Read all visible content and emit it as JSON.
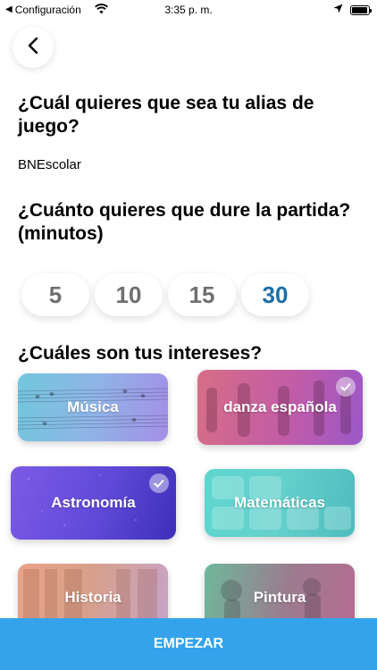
{
  "status_bar": {
    "back_app": "Configuración",
    "time": "3:35 p. m.",
    "battery_level": 0.95
  },
  "back_button": {
    "icon": "chevron-left-icon"
  },
  "alias_section": {
    "question": "¿Cuál quieres que sea tu alias de juego?",
    "value": "BNEscolar"
  },
  "duration_section": {
    "question": "¿Cuánto quieres que dure la partida? (minutos)",
    "options": [
      "5",
      "10",
      "15",
      "30"
    ],
    "selected": "30",
    "accent_color": "#1b6fa8"
  },
  "interests_section": {
    "question": "¿Cuáles son tus intereses?",
    "items": [
      {
        "label": "Música",
        "selected": false
      },
      {
        "label": "danza española",
        "selected": true
      },
      {
        "label": "Astronomía",
        "selected": true
      },
      {
        "label": "Matemáticas",
        "selected": false
      },
      {
        "label": "Historia",
        "selected": false
      },
      {
        "label": "Pintura",
        "selected": false
      }
    ]
  },
  "start_button": {
    "label": "EMPEZAR",
    "color": "#34a3ec"
  }
}
